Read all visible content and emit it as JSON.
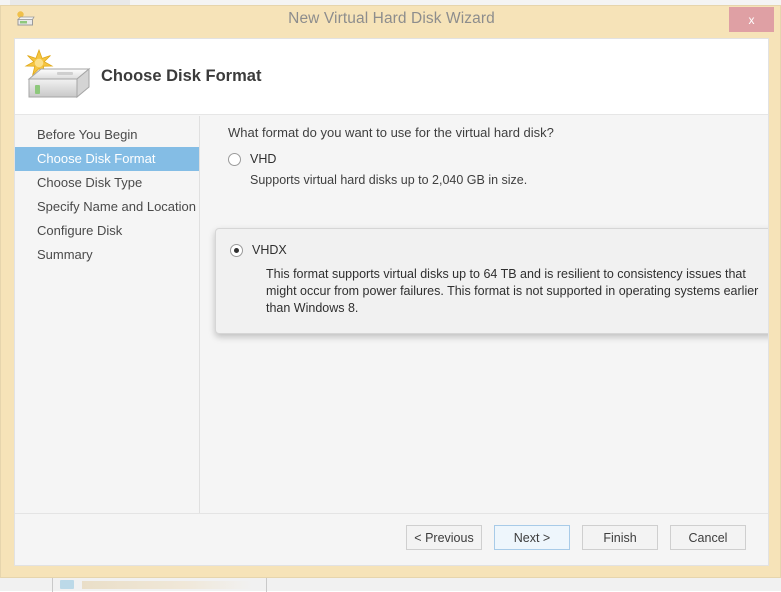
{
  "window": {
    "title": "New Virtual Hard Disk Wizard",
    "title_icon": "virtual-hard-disk-icon",
    "close_label": "x",
    "close_color": "#dfa0a4",
    "chrome_color": "#f6e3b8"
  },
  "header": {
    "title": "Choose Disk Format",
    "icon": "new-hard-disk-icon"
  },
  "sidebar": {
    "selected_color": "#84bde5",
    "items": [
      {
        "label": "Before You Begin",
        "selected": false
      },
      {
        "label": "Choose Disk Format",
        "selected": true
      },
      {
        "label": "Choose Disk Type",
        "selected": false
      },
      {
        "label": "Specify Name and Location",
        "selected": false
      },
      {
        "label": "Configure Disk",
        "selected": false
      },
      {
        "label": "Summary",
        "selected": false
      }
    ]
  },
  "content": {
    "question": "What format do you want to use for the virtual hard disk?",
    "vhd": {
      "label": "VHD",
      "selected": false,
      "description": "Supports virtual hard disks up to 2,040 GB in size."
    },
    "vhdx": {
      "label": "VHDX",
      "selected": true,
      "description": "This format supports virtual disks up to 64 TB and is resilient to consistency issues that might occur from power failures. This format is not supported in operating systems earlier than Windows 8."
    }
  },
  "footer": {
    "previous_label": "< Previous",
    "next_label": "Next >",
    "finish_label": "Finish",
    "cancel_label": "Cancel"
  }
}
